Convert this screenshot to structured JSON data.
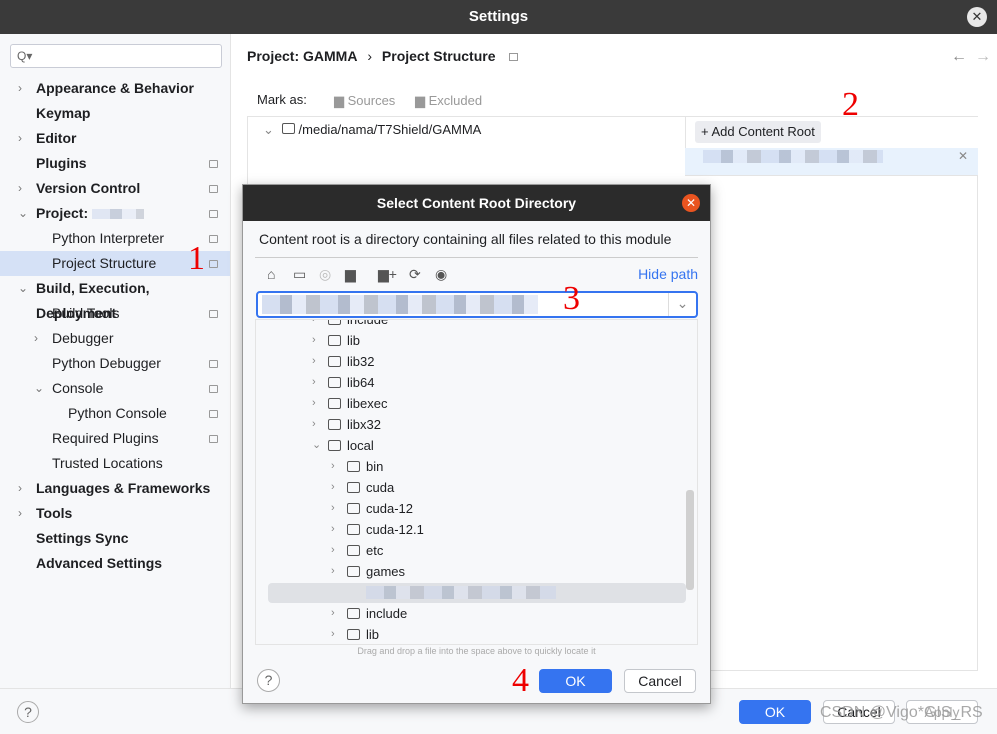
{
  "window": {
    "title": "Settings",
    "close": "✕"
  },
  "sidebar": {
    "search_placeholder": "Q▾",
    "items": [
      {
        "label": "Appearance & Behavior",
        "chev": "›",
        "bold": true,
        "indent": 0,
        "badge": false
      },
      {
        "label": "Keymap",
        "chev": "",
        "bold": true,
        "indent": 0,
        "badge": false
      },
      {
        "label": "Editor",
        "chev": "›",
        "bold": true,
        "indent": 0,
        "badge": false
      },
      {
        "label": "Plugins",
        "chev": "",
        "bold": true,
        "indent": 0,
        "badge": true
      },
      {
        "label": "Version Control",
        "chev": "›",
        "bold": true,
        "indent": 0,
        "badge": true
      },
      {
        "label": "Project:",
        "chev": "⌄",
        "bold": true,
        "indent": 0,
        "badge": true
      },
      {
        "label": "Python Interpreter",
        "chev": "",
        "bold": false,
        "indent": 1,
        "badge": true
      },
      {
        "label": "Project Structure",
        "chev": "",
        "bold": false,
        "indent": 1,
        "badge": true,
        "selected": true
      },
      {
        "label": "Build, Execution, Deployment",
        "chev": "⌄",
        "bold": true,
        "indent": 0,
        "badge": false
      },
      {
        "label": "Build Tools",
        "chev": "",
        "bold": false,
        "indent": 1,
        "badge": true
      },
      {
        "label": "Debugger",
        "chev": "›",
        "bold": false,
        "indent": 1,
        "badge": false
      },
      {
        "label": "Python Debugger",
        "chev": "",
        "bold": false,
        "indent": 1,
        "badge": true
      },
      {
        "label": "Console",
        "chev": "⌄",
        "bold": false,
        "indent": 1,
        "badge": true
      },
      {
        "label": "Python Console",
        "chev": "",
        "bold": false,
        "indent": 2,
        "badge": true
      },
      {
        "label": "Required Plugins",
        "chev": "",
        "bold": false,
        "indent": 1,
        "badge": true
      },
      {
        "label": "Trusted Locations",
        "chev": "",
        "bold": false,
        "indent": 1,
        "badge": false
      },
      {
        "label": "Languages & Frameworks",
        "chev": "›",
        "bold": true,
        "indent": 0,
        "badge": false
      },
      {
        "label": "Tools",
        "chev": "›",
        "bold": true,
        "indent": 0,
        "badge": false
      },
      {
        "label": "Settings Sync",
        "chev": "",
        "bold": true,
        "indent": 0,
        "badge": false
      },
      {
        "label": "Advanced Settings",
        "chev": "",
        "bold": true,
        "indent": 0,
        "badge": false
      }
    ]
  },
  "main": {
    "breadcrumb": [
      "Project: GAMMA",
      "›",
      "Project Structure"
    ],
    "back": "←",
    "forward": "→",
    "mark_as": "Mark as:",
    "sources": "Sources",
    "excluded": "Excluded",
    "root_path": "/media/nama/T7Shield/GAMMA",
    "add_content_root": "Add Content Root"
  },
  "dialog": {
    "title": "Select Content Root Directory",
    "description": "Content root is a directory containing all files related to this module",
    "hide_path": "Hide path",
    "dropdown": "⌄",
    "tree": [
      {
        "label": "include",
        "level": 1,
        "open": false
      },
      {
        "label": "lib",
        "level": 1,
        "open": false
      },
      {
        "label": "lib32",
        "level": 1,
        "open": false
      },
      {
        "label": "lib64",
        "level": 1,
        "open": false
      },
      {
        "label": "libexec",
        "level": 1,
        "open": false
      },
      {
        "label": "libx32",
        "level": 1,
        "open": false
      },
      {
        "label": "local",
        "level": 1,
        "open": true
      },
      {
        "label": "bin",
        "level": 2,
        "open": false
      },
      {
        "label": "cuda",
        "level": 2,
        "open": false
      },
      {
        "label": "cuda-12",
        "level": 2,
        "open": false
      },
      {
        "label": "cuda-12.1",
        "level": 2,
        "open": false
      },
      {
        "label": "etc",
        "level": 2,
        "open": false
      },
      {
        "label": "games",
        "level": 2,
        "open": false
      },
      {
        "label": "",
        "level": 2,
        "open": false,
        "selected": true
      },
      {
        "label": "include",
        "level": 2,
        "open": false
      },
      {
        "label": "lib",
        "level": 2,
        "open": false
      }
    ],
    "hint": "Drag and drop a file into the space above to quickly locate it",
    "help": "?",
    "ok": "OK",
    "cancel": "Cancel"
  },
  "footer": {
    "help": "?",
    "ok": "OK",
    "cancel": "Cancel",
    "apply": "Apply"
  },
  "annotations": [
    "1",
    "2",
    "3",
    "4"
  ],
  "watermark": "CSDN @Vigo*GIS_RS"
}
